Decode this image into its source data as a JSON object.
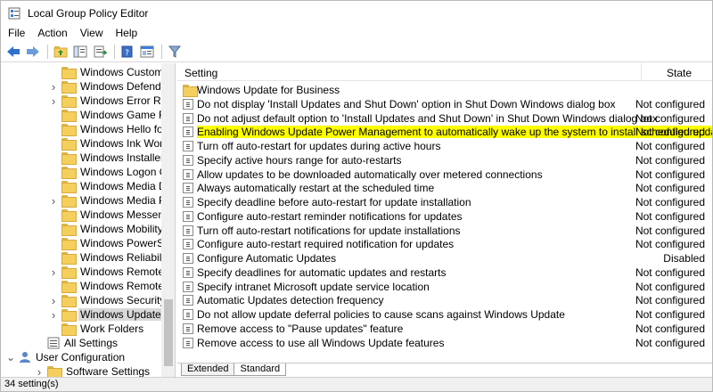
{
  "window": {
    "title": "Local Group Policy Editor"
  },
  "menu": [
    "File",
    "Action",
    "View",
    "Help"
  ],
  "tree": {
    "items": [
      {
        "label": "Windows Customer Ex",
        "indent": 2,
        "expander": false
      },
      {
        "label": "Windows Defender Sn",
        "indent": 2,
        "expander": true
      },
      {
        "label": "Windows Error Report",
        "indent": 2,
        "expander": true
      },
      {
        "label": "Windows Game Recor",
        "indent": 2,
        "expander": false
      },
      {
        "label": "Windows Hello for Bu",
        "indent": 2,
        "expander": false
      },
      {
        "label": "Windows Ink Workspa",
        "indent": 2,
        "expander": false
      },
      {
        "label": "Windows Installer",
        "indent": 2,
        "expander": false
      },
      {
        "label": "Windows Logon Optic",
        "indent": 2,
        "expander": false
      },
      {
        "label": "Windows Media Digita",
        "indent": 2,
        "expander": false
      },
      {
        "label": "Windows Media Playe",
        "indent": 2,
        "expander": true
      },
      {
        "label": "Windows Messenger",
        "indent": 2,
        "expander": false
      },
      {
        "label": "Windows Mobility Cer",
        "indent": 2,
        "expander": false
      },
      {
        "label": "Windows PowerShell",
        "indent": 2,
        "expander": false
      },
      {
        "label": "Windows Reliability A",
        "indent": 2,
        "expander": false
      },
      {
        "label": "Windows Remote Mar",
        "indent": 2,
        "expander": true
      },
      {
        "label": "Windows Remote She",
        "indent": 2,
        "expander": false
      },
      {
        "label": "Windows Security",
        "indent": 2,
        "expander": true
      },
      {
        "label": "Windows Update",
        "indent": 2,
        "expander": true,
        "selected": true
      },
      {
        "label": "Work Folders",
        "indent": 2,
        "expander": false
      },
      {
        "label": "All Settings",
        "indent": 1,
        "expander": false
      },
      {
        "label": "User Configuration",
        "indent": 0,
        "expander": true,
        "expanded": true
      },
      {
        "label": "Software Settings",
        "indent": 1,
        "expander": true
      }
    ]
  },
  "list": {
    "columns": {
      "setting": "Setting",
      "state": "State"
    },
    "rows": [
      {
        "name": "Windows Update for Business",
        "state": "",
        "type": "folder"
      },
      {
        "name": "Do not display 'Install Updates and Shut Down' option in Shut Down Windows dialog box",
        "state": "Not configured",
        "type": "setting"
      },
      {
        "name": "Do not adjust default option to 'Install Updates and Shut Down' in Shut Down Windows dialog box",
        "state": "Not configured",
        "type": "setting"
      },
      {
        "name": "Enabling Windows Update Power Management to automatically wake up the system to install scheduled updates",
        "state": "Not configured",
        "type": "setting",
        "highlight": true
      },
      {
        "name": "Turn off auto-restart for updates during active hours",
        "state": "Not configured",
        "type": "setting"
      },
      {
        "name": "Specify active hours range for auto-restarts",
        "state": "Not configured",
        "type": "setting"
      },
      {
        "name": "Allow updates to be downloaded automatically over metered connections",
        "state": "Not configured",
        "type": "setting"
      },
      {
        "name": "Always automatically restart at the scheduled time",
        "state": "Not configured",
        "type": "setting"
      },
      {
        "name": "Specify deadline before auto-restart for update installation",
        "state": "Not configured",
        "type": "setting"
      },
      {
        "name": "Configure auto-restart reminder notifications for updates",
        "state": "Not configured",
        "type": "setting"
      },
      {
        "name": "Turn off auto-restart notifications for update installations",
        "state": "Not configured",
        "type": "setting"
      },
      {
        "name": "Configure auto-restart required notification for updates",
        "state": "Not configured",
        "type": "setting"
      },
      {
        "name": "Configure Automatic Updates",
        "state": "Disabled",
        "type": "setting"
      },
      {
        "name": "Specify deadlines for automatic updates and restarts",
        "state": "Not configured",
        "type": "setting"
      },
      {
        "name": "Specify intranet Microsoft update service location",
        "state": "Not configured",
        "type": "setting"
      },
      {
        "name": "Automatic Updates detection frequency",
        "state": "Not configured",
        "type": "setting"
      },
      {
        "name": "Do not allow update deferral policies to cause scans against Windows Update",
        "state": "Not configured",
        "type": "setting"
      },
      {
        "name": "Remove access to \"Pause updates\" feature",
        "state": "Not configured",
        "type": "setting"
      },
      {
        "name": "Remove access to use all Windows Update features",
        "state": "Not configured",
        "type": "setting"
      }
    ]
  },
  "tabs": [
    "Extended",
    "Standard"
  ],
  "status": "34 setting(s)",
  "colors": {
    "highlight": "#ffff00",
    "selected": "#d9d9d9",
    "folder": "#f5cf5e"
  }
}
